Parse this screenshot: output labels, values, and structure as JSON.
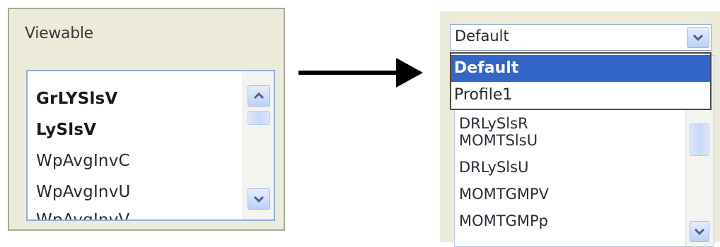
{
  "left_panel": {
    "label": "Viewable",
    "items": [
      {
        "text": "GrLYSlsV"
      },
      {
        "text": "LySlsV"
      },
      {
        "text": "WpAvgInvC"
      },
      {
        "text": "WpAvgInvU"
      },
      {
        "text": "WpAvgInvV"
      }
    ]
  },
  "right_panel": {
    "combo_value": "Default",
    "dropdown_options": [
      {
        "text": "Default",
        "selected": true
      },
      {
        "text": "Profile1",
        "selected": false
      }
    ],
    "list_items": [
      {
        "text": "DRLySlsR"
      },
      {
        "text": "MOMTSlsU"
      },
      {
        "text": "DRLySlsU"
      },
      {
        "text": "MOMTGMPV"
      },
      {
        "text": "MOMTGMPp"
      }
    ]
  },
  "icons": {
    "scroll_up": "chevron-up-icon",
    "scroll_down": "chevron-down-icon",
    "dropdown": "chevron-down-icon",
    "transition": "arrow-right-icon"
  },
  "colors": {
    "panel_bg": "#ecead9",
    "selection": "#3465c8",
    "scroll_button": "#bcd0f6",
    "list_border": "#8cb0d8"
  }
}
